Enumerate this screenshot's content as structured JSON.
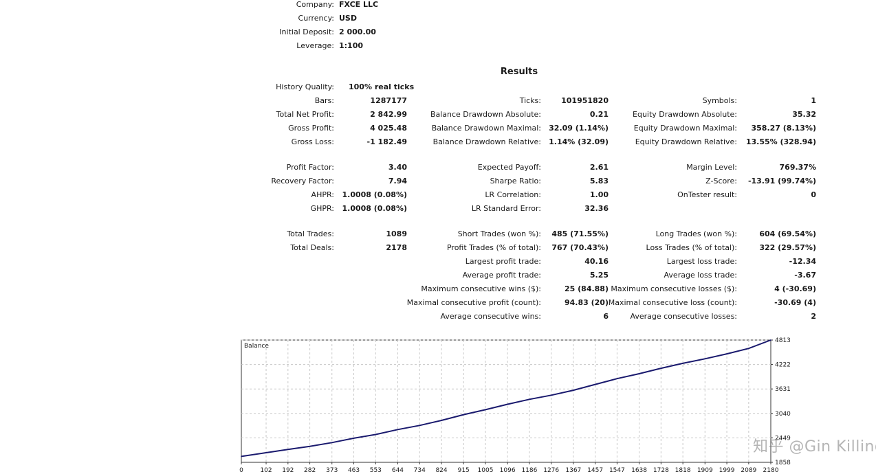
{
  "header": {
    "company_label": "Company:",
    "company_value": "FXCE LLC",
    "currency_label": "Currency:",
    "currency_value": "USD",
    "initial_deposit_label": "Initial Deposit:",
    "initial_deposit_value": "2 000.00",
    "leverage_label": "Leverage:",
    "leverage_value": "1:100"
  },
  "results": {
    "title": "Results",
    "history_quality_label": "History Quality:",
    "history_quality_value": "100% real ticks",
    "col1": [
      {
        "label": "Bars:",
        "value": "1287177"
      },
      {
        "label": "Total Net Profit:",
        "value": "2 842.99"
      },
      {
        "label": "Gross Profit:",
        "value": "4 025.48"
      },
      {
        "label": "Gross Loss:",
        "value": "-1 182.49"
      },
      {
        "label": "Profit Factor:",
        "value": "3.40"
      },
      {
        "label": "Recovery Factor:",
        "value": "7.94"
      },
      {
        "label": "AHPR:",
        "value": "1.0008 (0.08%)"
      },
      {
        "label": "GHPR:",
        "value": "1.0008 (0.08%)"
      },
      {
        "label": "Total Trades:",
        "value": "1089"
      },
      {
        "label": "Total Deals:",
        "value": "2178"
      }
    ],
    "col2": [
      {
        "label": "Ticks:",
        "value": "101951820"
      },
      {
        "label": "Balance Drawdown Absolute:",
        "value": "0.21"
      },
      {
        "label": "Balance Drawdown Maximal:",
        "value": "32.09 (1.14%)"
      },
      {
        "label": "Balance Drawdown Relative:",
        "value": "1.14% (32.09)"
      },
      {
        "label": "Expected Payoff:",
        "value": "2.61"
      },
      {
        "label": "Sharpe Ratio:",
        "value": "5.83"
      },
      {
        "label": "LR Correlation:",
        "value": "1.00"
      },
      {
        "label": "LR Standard Error:",
        "value": "32.36"
      },
      {
        "label": "Short Trades (won %):",
        "value": "485 (71.55%)"
      },
      {
        "label": "Profit Trades (% of total):",
        "value": "767 (70.43%)"
      },
      {
        "label": "Largest profit trade:",
        "value": "40.16"
      },
      {
        "label": "Average profit trade:",
        "value": "5.25"
      },
      {
        "label": "Maximum consecutive wins ($):",
        "value": "25 (84.88)"
      },
      {
        "label": "Maximal consecutive profit (count):",
        "value": "94.83 (20)"
      },
      {
        "label": "Average consecutive wins:",
        "value": "6"
      }
    ],
    "col3": [
      {
        "label": "Symbols:",
        "value": "1"
      },
      {
        "label": "Equity Drawdown Absolute:",
        "value": "35.32"
      },
      {
        "label": "Equity Drawdown Maximal:",
        "value": "358.27 (8.13%)"
      },
      {
        "label": "Equity Drawdown Relative:",
        "value": "13.55% (328.94)"
      },
      {
        "label": "Margin Level:",
        "value": "769.37%"
      },
      {
        "label": "Z-Score:",
        "value": "-13.91 (99.74%)"
      },
      {
        "label": "OnTester result:",
        "value": "0"
      },
      {
        "label": "Long Trades (won %):",
        "value": "604 (69.54%)"
      },
      {
        "label": "Loss Trades (% of total):",
        "value": "322 (29.57%)"
      },
      {
        "label": "Largest loss trade:",
        "value": "-12.34"
      },
      {
        "label": "Average loss trade:",
        "value": "-3.67"
      },
      {
        "label": "Maximum consecutive losses ($):",
        "value": "4 (-30.69)"
      },
      {
        "label": "Maximal consecutive loss (count):",
        "value": "-30.69 (4)"
      },
      {
        "label": "Average consecutive losses:",
        "value": "2"
      }
    ]
  },
  "watermark": "知乎 @Gin Killing",
  "chart_data": {
    "type": "line",
    "title": "Balance",
    "xlabel": "",
    "ylabel": "",
    "x_ticks": [
      0,
      102,
      192,
      282,
      373,
      463,
      553,
      644,
      734,
      824,
      915,
      1005,
      1096,
      1186,
      1276,
      1367,
      1457,
      1547,
      1638,
      1728,
      1818,
      1909,
      1999,
      2089,
      2180
    ],
    "y_ticks": [
      1858,
      2449,
      3040,
      3631,
      4222,
      4813
    ],
    "xlim": [
      0,
      2180
    ],
    "ylim": [
      1858,
      4813
    ],
    "grid": true,
    "line_color": "#1a1a6e",
    "series": [
      {
        "x": [
          0,
          102,
          192,
          282,
          373,
          463,
          553,
          644,
          734,
          824,
          915,
          1005,
          1096,
          1186,
          1276,
          1367,
          1457,
          1547,
          1638,
          1728,
          1818,
          1909,
          1999,
          2089,
          2180
        ],
        "values": [
          2000,
          2090,
          2170,
          2245,
          2335,
          2440,
          2530,
          2650,
          2750,
          2870,
          3010,
          3130,
          3260,
          3380,
          3480,
          3600,
          3740,
          3880,
          4000,
          4130,
          4250,
          4360,
          4480,
          4610,
          4813
        ]
      }
    ]
  }
}
